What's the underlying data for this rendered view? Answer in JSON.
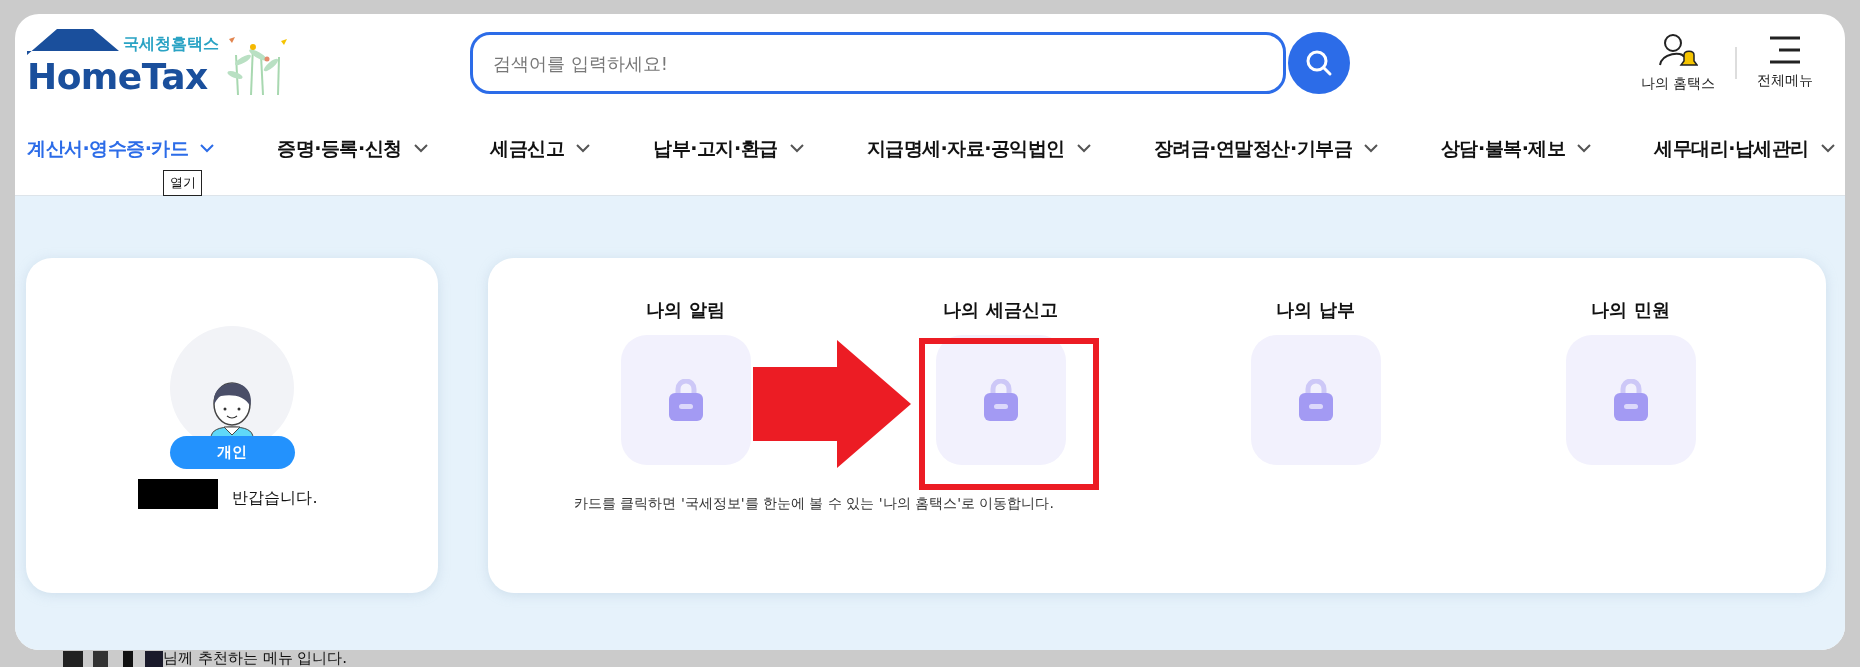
{
  "logo": {
    "subtitle": "국세청홈택스",
    "title": "HomeTax"
  },
  "search": {
    "placeholder": "검색어를 입력하세요!"
  },
  "header_links": [
    {
      "label": "나의 홈택스",
      "kind": "my"
    },
    {
      "label": "전체메뉴",
      "kind": "menu"
    }
  ],
  "nav": [
    {
      "label": "계산서·영수증·카드",
      "selected": true,
      "tooltip": "열기"
    },
    {
      "label": "증명·등록·신청",
      "selected": false
    },
    {
      "label": "세금신고",
      "selected": false
    },
    {
      "label": "납부·고지·환급",
      "selected": false
    },
    {
      "label": "지급명세·자료·공익법인",
      "selected": false
    },
    {
      "label": "장려금·연말정산·기부금",
      "selected": false
    },
    {
      "label": "상담·불복·제보",
      "selected": false
    },
    {
      "label": "세무대리·납세관리",
      "selected": false
    }
  ],
  "profile": {
    "badge": "개인",
    "greeting": "반갑습니다."
  },
  "my_cards": [
    {
      "title": "나의 알림",
      "locked": true,
      "highlighted": false
    },
    {
      "title": "나의 세금신고",
      "locked": true,
      "highlighted": true
    },
    {
      "title": "나의 납부",
      "locked": true,
      "highlighted": false
    },
    {
      "title": "나의 민원",
      "locked": true,
      "highlighted": false
    }
  ],
  "cards_note": "카드를 클릭하면 '국세정보'를 한눈에 볼 수 있는 '나의 홈택스'로 이동합니다.",
  "recommend_note": "님께 추천하는 메뉴 입니다."
}
